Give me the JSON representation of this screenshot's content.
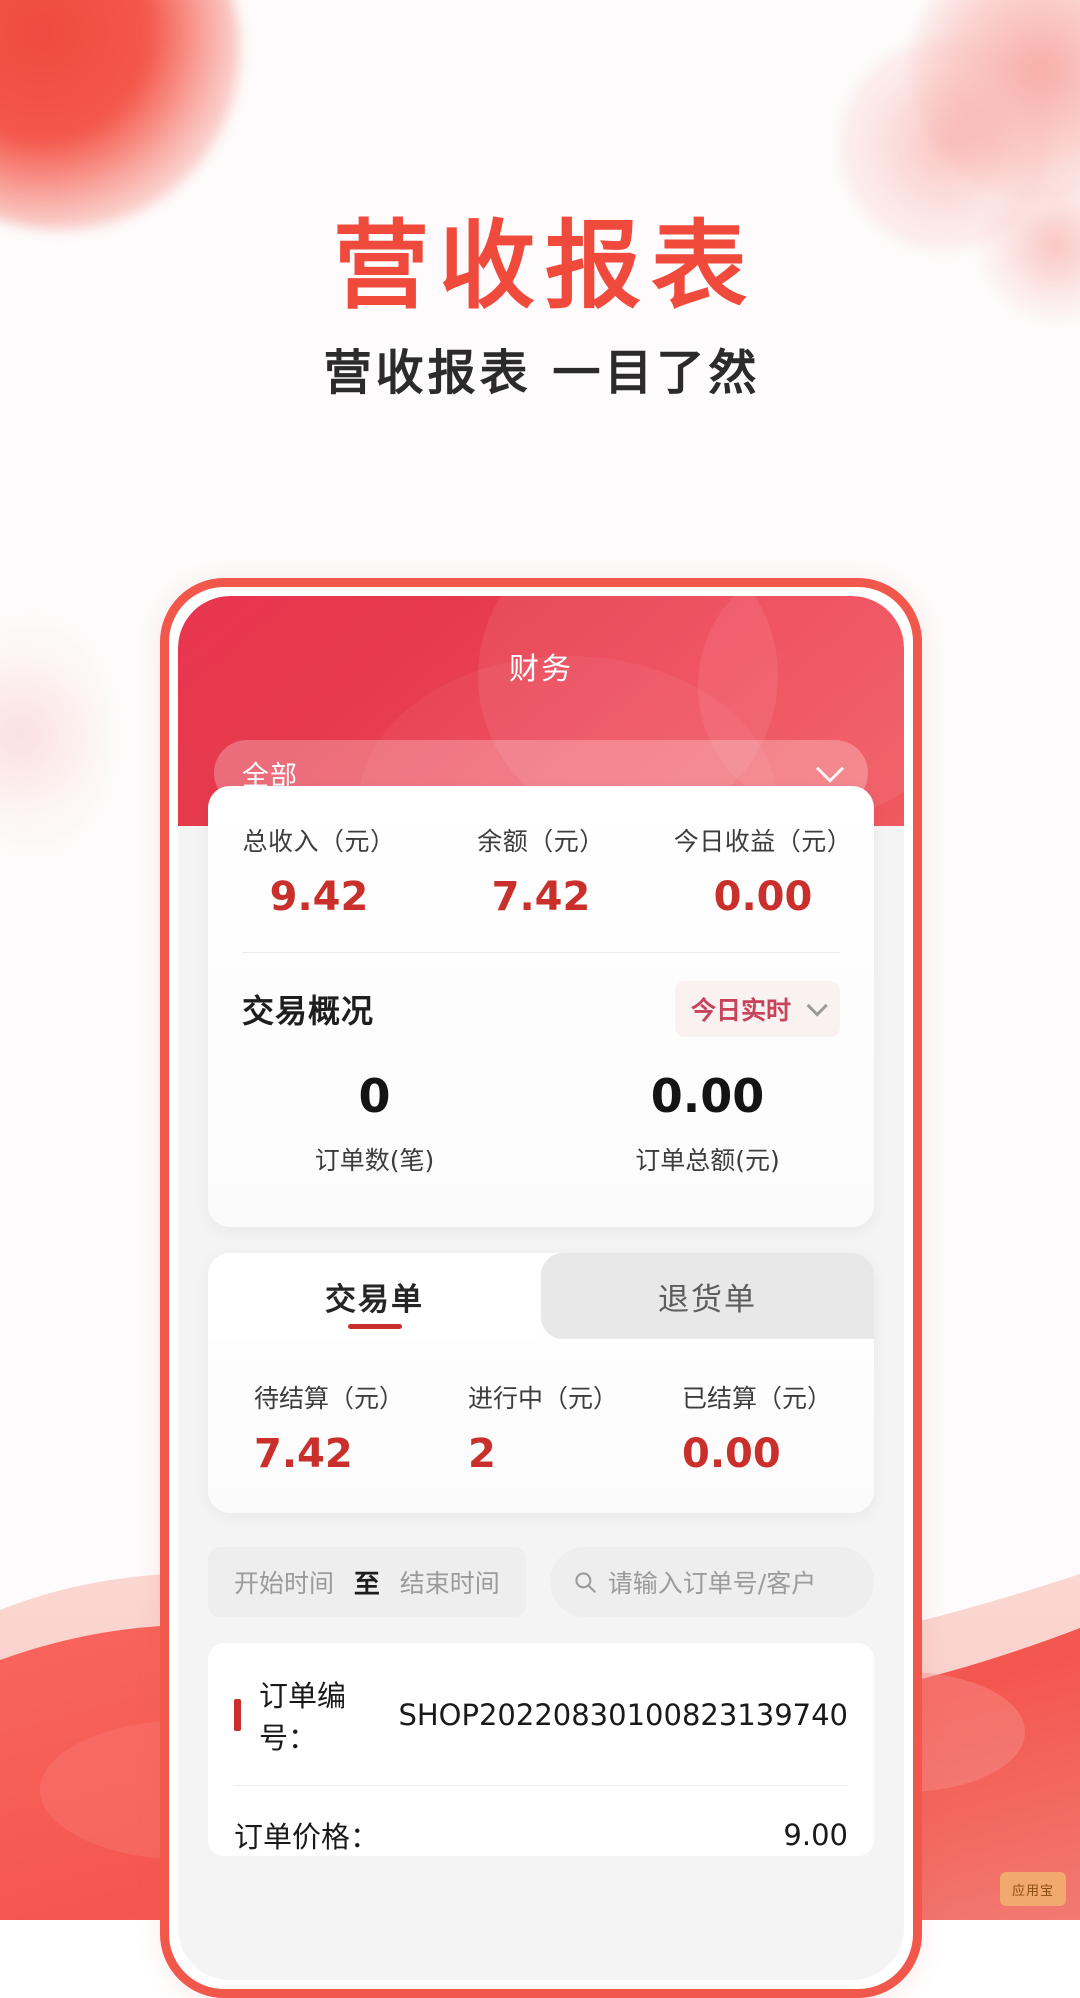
{
  "promo": {
    "title": "营收报表",
    "subtitle": "营收报表 一目了然",
    "accent_color": "#f04a3c",
    "brand_red": "#e8354f"
  },
  "app": {
    "header_title": "财务",
    "scope_select": {
      "value": "全部",
      "icon": "chevron-down-icon"
    },
    "overview_stats": [
      {
        "caption": "总收入（元）",
        "value": "9.42"
      },
      {
        "caption": "余额（元）",
        "value": "7.42"
      },
      {
        "caption": "今日收益（元）",
        "value": "0.00"
      }
    ],
    "transaction_overview": {
      "title": "交易概况",
      "period_chip": {
        "label": "今日实时",
        "icon": "chevron-down-icon"
      },
      "metrics": [
        {
          "value": "0",
          "label": "订单数(笔)"
        },
        {
          "value": "0.00",
          "label": "订单总额(元)"
        }
      ]
    },
    "tabs": [
      {
        "label": "交易单",
        "active": true
      },
      {
        "label": "退货单",
        "active": false
      }
    ],
    "settlement_stats": [
      {
        "caption": "待结算（元）",
        "value": "7.42"
      },
      {
        "caption": "进行中（元）",
        "value": "2"
      },
      {
        "caption": "已结算（元）",
        "value": "0.00"
      }
    ],
    "filters": {
      "start_time_placeholder": "开始时间",
      "range_separator": "至",
      "end_time_placeholder": "结束时间",
      "search_placeholder": "请输入订单号/客户",
      "search_icon": "search-icon"
    },
    "orders": [
      {
        "number_label": "订单编号：",
        "number_value": "SHOP20220830100823139740",
        "price_label": "订单价格：",
        "price_value": "9.00"
      }
    ]
  },
  "watermark": {
    "text": "应用宝"
  }
}
